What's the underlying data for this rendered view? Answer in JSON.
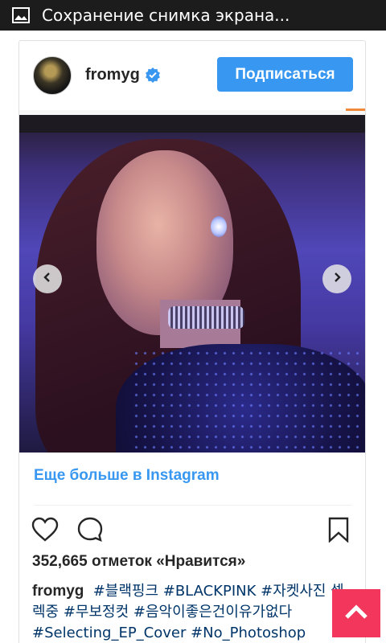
{
  "statusbar": {
    "title": "Сохранение снимка экрана...",
    "icon": "image-icon"
  },
  "post": {
    "username": "fromyg",
    "verified": true,
    "follow_label": "Подписаться",
    "more_link": "Еще больше в Instagram",
    "likes": "352,665 отметок «Нравится»",
    "caption_user": "fromyg",
    "caption_tags": "#블랙핑크 #BLACKPINK #자켓사진 셀렉중 #무보정컷 #음악이좋은건이유가없다 #Selecting_EP_Cover #No_Photoshop"
  },
  "colors": {
    "accent": "#3897f0",
    "scroll_top": "#f2365c",
    "statusbar": "#1c1c1c"
  },
  "icons": {
    "prev": "chevron-left-icon",
    "next": "chevron-right-icon",
    "like": "heart-icon",
    "comment": "comment-icon",
    "save": "bookmark-icon",
    "scroll_top": "chevron-up-icon"
  }
}
